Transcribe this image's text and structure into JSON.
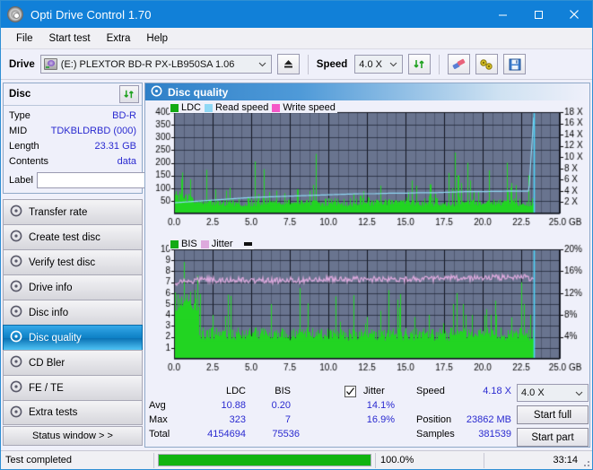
{
  "window": {
    "title": "Opti Drive Control 1.70",
    "icon": "disc-icon",
    "minimize": "minimize",
    "maximize": "maximize",
    "close": "close"
  },
  "menu": {
    "items": [
      "File",
      "Start test",
      "Extra",
      "Help"
    ]
  },
  "toolbar": {
    "drive_label": "Drive",
    "drive_value": "(E:)  PLEXTOR BD-R  PX-LB950SA 1.06",
    "eject_icon": "eject-icon",
    "speed_label": "Speed",
    "speed_value": "4.0 X",
    "refresh_icon": "refresh-icon",
    "eraser_icon": "eraser-icon",
    "tools_icon": "tools-icon",
    "save_icon": "save-icon"
  },
  "disc": {
    "header": "Disc",
    "refresh_icon": "refresh-icon",
    "rows": [
      {
        "key": "Type",
        "value": "BD-R"
      },
      {
        "key": "MID",
        "value": "TDKBLDRBD (000)"
      },
      {
        "key": "Length",
        "value": "23.31 GB"
      },
      {
        "key": "Contents",
        "value": "data"
      }
    ],
    "label_key": "Label",
    "label_value": "",
    "label_placeholder": "",
    "label_icon": "disc-label-icon"
  },
  "sidebar": {
    "items": [
      {
        "label": "Transfer rate",
        "icon": "disc-icon",
        "active": false
      },
      {
        "label": "Create test disc",
        "icon": "disc-icon",
        "active": false
      },
      {
        "label": "Verify test disc",
        "icon": "disc-icon",
        "active": false
      },
      {
        "label": "Drive info",
        "icon": "disc-icon",
        "active": false
      },
      {
        "label": "Disc info",
        "icon": "disc-icon",
        "active": false
      },
      {
        "label": "Disc quality",
        "icon": "disc-icon",
        "active": true
      },
      {
        "label": "CD Bler",
        "icon": "disc-icon",
        "active": false
      },
      {
        "label": "FE / TE",
        "icon": "disc-icon",
        "active": false
      },
      {
        "label": "Extra tests",
        "icon": "disc-icon",
        "active": false
      }
    ],
    "status_window_button": "Status window > >"
  },
  "panel": {
    "title": "Disc quality",
    "icon": "disc-icon"
  },
  "stats": {
    "col_ldc": "LDC",
    "col_bis": "BIS",
    "jitter_label": "Jitter",
    "jitter_checked": true,
    "rows": [
      {
        "name": "Avg",
        "ldc": "10.88",
        "bis": "0.20",
        "jitter": "14.1%"
      },
      {
        "name": "Max",
        "ldc": "323",
        "bis": "7",
        "jitter": "16.9%"
      },
      {
        "name": "Total",
        "ldc": "4154694",
        "bis": "75536",
        "jitter": ""
      }
    ],
    "speed_label": "Speed",
    "speed_value": "4.18 X",
    "position_label": "Position",
    "position_value": "23862 MB",
    "samples_label": "Samples",
    "samples_value": "381539",
    "speed_select": "4.0 X",
    "start_full_button": "Start full",
    "start_part_button": "Start part"
  },
  "statusbar": {
    "message": "Test completed",
    "progress_percent": "100.0%",
    "progress_value": 100,
    "elapsed": "33:14"
  },
  "colors": {
    "accent": "#1180d8",
    "plot_bg": "#69748f",
    "ldc_green": "#22d422",
    "read_speed": "#8fd8f5",
    "write_speed": "#f558c8",
    "jitter_pink": "#dda9dd",
    "value_blue": "#2a2ad0",
    "progress_green": "#11b411"
  },
  "chart_data": [
    {
      "type": "area",
      "title": "LDC / Read speed",
      "xlabel": "GB",
      "ylabel": "LDC",
      "xlim": [
        0,
        25.0
      ],
      "ylim": [
        0,
        400
      ],
      "xticks": [
        "0.0",
        "2.5",
        "5.0",
        "7.5",
        "10.0",
        "12.5",
        "15.0",
        "17.5",
        "20.0",
        "22.5",
        "25.0 GB"
      ],
      "yticks": [
        "400",
        "350",
        "300",
        "250",
        "200",
        "150",
        "100",
        "50"
      ],
      "y2label": "Speed",
      "y2lim": [
        0,
        19
      ],
      "y2ticks": [
        "18 X",
        "16 X",
        "14 X",
        "12 X",
        "10 X",
        "8 X",
        "6 X",
        "4 X",
        "2 X"
      ],
      "grid": true,
      "legend_position": "top-left",
      "legend": [
        {
          "name": "LDC",
          "color": "#13aa13"
        },
        {
          "name": "Read speed",
          "color": "#8fd8f5"
        },
        {
          "name": "Write speed",
          "color": "#f558c8"
        }
      ],
      "series": [
        {
          "name": "LDC",
          "color": "#22d422",
          "type": "impulse",
          "x": [
            0.0,
            0.1,
            0.2,
            0.3,
            0.4,
            0.5,
            0.6,
            0.7,
            0.8,
            0.9,
            1.0,
            1.1,
            1.2,
            1.3,
            1.4,
            1.5,
            1.6,
            1.7,
            1.8,
            1.9,
            2.0,
            2.1,
            2.2,
            2.3,
            2.4,
            2.5,
            2.6,
            2.7,
            2.8,
            2.9,
            3.0,
            3.2,
            3.4,
            3.6,
            3.8,
            4.0,
            4.2,
            4.4,
            4.6,
            4.8,
            5.0,
            5.2,
            5.4,
            5.6,
            5.8,
            6.0,
            6.2,
            6.4,
            6.6,
            6.8,
            7.0,
            7.2,
            7.4,
            7.6,
            7.8,
            8.0,
            8.2,
            8.4,
            8.6,
            8.8,
            9.0,
            9.2,
            9.4,
            9.6,
            9.8,
            10.0,
            10.2,
            10.4,
            10.6,
            10.8,
            11.0,
            11.4,
            11.8,
            12.2,
            12.6,
            13.0,
            13.4,
            13.8,
            14.2,
            14.6,
            15.0,
            15.4,
            15.8,
            16.2,
            16.6,
            17.0,
            17.4,
            17.8,
            18.0,
            18.2,
            18.4,
            18.6,
            18.8,
            19.0,
            19.2,
            19.4,
            19.6,
            19.8,
            20.0,
            20.2,
            20.4,
            20.8,
            21.2,
            21.6,
            22.0,
            22.4,
            22.8,
            23.0,
            23.2,
            23.3
          ],
          "values": [
            60,
            95,
            85,
            75,
            70,
            65,
            60,
            185,
            62,
            58,
            60,
            58,
            55,
            60,
            58,
            55,
            62,
            188,
            55,
            58,
            60,
            172,
            58,
            60,
            62,
            60,
            58,
            95,
            60,
            58,
            57,
            60,
            90,
            58,
            60,
            62,
            58,
            60,
            90,
            60,
            58,
            205,
            58,
            60,
            175,
            60,
            58,
            60,
            90,
            60,
            58,
            60,
            58,
            60,
            58,
            95,
            60,
            58,
            60,
            58,
            60,
            235,
            58,
            60,
            58,
            60,
            58,
            60,
            58,
            60,
            58,
            60,
            58,
            60,
            62,
            60,
            110,
            58,
            60,
            58,
            60,
            130,
            58,
            60,
            115,
            60,
            58,
            160,
            100,
            240,
            150,
            120,
            290,
            200,
            130,
            90,
            70,
            60,
            58,
            60,
            170,
            60,
            58,
            200,
            60,
            58,
            280,
            150,
            60,
            58
          ]
        },
        {
          "name": "Read speed",
          "color": "#8fd8f5",
          "type": "line",
          "x": [
            0.0,
            1.0,
            2.0,
            3.0,
            4.0,
            5.0,
            6.0,
            7.0,
            8.0,
            9.0,
            10.0,
            11.0,
            12.0,
            13.0,
            14.0,
            15.0,
            16.0,
            17.0,
            18.0,
            19.0,
            20.0,
            21.0,
            22.0,
            23.0,
            23.3
          ],
          "values": [
            2.0,
            2.2,
            2.4,
            2.6,
            2.8,
            3.0,
            3.1,
            3.2,
            3.3,
            3.4,
            3.5,
            3.6,
            3.7,
            3.7,
            3.8,
            3.8,
            3.9,
            3.9,
            4.0,
            4.1,
            4.1,
            4.15,
            4.18,
            4.2,
            18.0
          ]
        }
      ]
    },
    {
      "type": "area",
      "title": "BIS / Jitter",
      "xlabel": "GB",
      "ylabel": "BIS",
      "xlim": [
        0,
        25.0
      ],
      "ylim": [
        0,
        10
      ],
      "xticks": [
        "0.0",
        "2.5",
        "5.0",
        "7.5",
        "10.0",
        "12.5",
        "15.0",
        "17.5",
        "20.0",
        "22.5",
        "25.0 GB"
      ],
      "yticks": [
        "10",
        "9",
        "8",
        "7",
        "6",
        "5",
        "4",
        "3",
        "2",
        "1"
      ],
      "y2label": "Jitter",
      "y2lim": [
        0,
        20
      ],
      "y2ticks": [
        "20%",
        "16%",
        "12%",
        "8%",
        "4%"
      ],
      "grid": true,
      "legend_position": "top-left",
      "legend": [
        {
          "name": "BIS",
          "color": "#13aa13"
        },
        {
          "name": "Jitter",
          "color": "#dda9dd"
        }
      ],
      "series": [
        {
          "name": "BIS",
          "color": "#22d422",
          "type": "impulse",
          "x": [
            0.0,
            0.1,
            0.2,
            0.3,
            0.4,
            0.5,
            0.6,
            0.7,
            0.8,
            0.9,
            1.0,
            1.1,
            1.2,
            1.3,
            1.4,
            1.5,
            1.7,
            1.9,
            2.1,
            2.3,
            2.5,
            2.7,
            2.9,
            3.1,
            3.3,
            3.5,
            3.7,
            3.9,
            4.1,
            4.3,
            4.5,
            4.7,
            4.9,
            5.1,
            5.3,
            5.5,
            5.7,
            5.9,
            6.1,
            6.3,
            6.5,
            6.7,
            6.9,
            7.3,
            7.7,
            8.1,
            8.5,
            8.9,
            9.3,
            9.7,
            10.1,
            10.5,
            10.9,
            11.3,
            11.7,
            12.1,
            12.5,
            12.9,
            13.3,
            13.7,
            14.1,
            14.5,
            14.9,
            15.3,
            15.7,
            16.1,
            16.5,
            16.9,
            17.3,
            17.7,
            18.1,
            18.3,
            18.5,
            18.7,
            18.9,
            19.1,
            19.3,
            19.5,
            19.7,
            19.9,
            20.1,
            20.5,
            20.9,
            21.3,
            21.7,
            22.1,
            22.5,
            22.7,
            22.9,
            23.1,
            23.3
          ],
          "values": [
            5,
            5,
            5,
            5,
            5,
            5,
            6,
            6,
            5,
            6,
            6,
            4,
            6,
            4,
            6,
            3,
            3,
            3,
            3,
            3,
            4,
            3,
            3,
            3,
            3,
            3,
            3,
            3,
            3,
            3,
            3,
            3,
            3,
            3,
            3,
            3,
            4,
            3,
            3,
            5,
            3,
            3,
            3,
            3,
            3,
            3,
            3,
            2,
            3,
            3,
            3,
            3,
            3,
            3,
            3,
            3,
            3,
            3,
            3,
            3,
            3,
            3,
            4,
            3,
            3,
            3,
            4,
            3,
            3,
            3,
            5,
            6,
            4,
            5,
            4,
            3,
            4,
            3,
            3,
            3,
            4,
            4,
            4,
            5,
            4,
            6,
            7,
            5,
            6,
            4,
            3
          ]
        },
        {
          "name": "Jitter",
          "color": "#dda9dd",
          "type": "line",
          "x": [
            0.0,
            0.5,
            1.0,
            1.5,
            2.0,
            2.5,
            3.0,
            3.5,
            4.0,
            4.5,
            5.0,
            5.5,
            6.0,
            6.5,
            7.0,
            7.5,
            8.0,
            8.5,
            9.0,
            9.5,
            10.0,
            10.5,
            11.0,
            11.5,
            12.0,
            12.5,
            13.0,
            13.5,
            14.0,
            14.5,
            15.0,
            15.5,
            16.0,
            16.5,
            17.0,
            17.5,
            18.0,
            18.5,
            19.0,
            19.5,
            20.0,
            20.5,
            21.0,
            21.5,
            22.0,
            22.5,
            23.0,
            23.3
          ],
          "values": [
            13.8,
            14.2,
            14.1,
            14.4,
            14.5,
            14.4,
            14.2,
            14.3,
            14.5,
            14.3,
            14.2,
            14.4,
            14.3,
            14.2,
            14.4,
            14.5,
            14.3,
            14.4,
            14.5,
            14.3,
            14.6,
            14.5,
            14.4,
            14.6,
            14.5,
            14.4,
            14.6,
            14.7,
            14.5,
            14.6,
            14.5,
            14.7,
            14.6,
            14.5,
            14.7,
            14.6,
            14.8,
            14.6,
            14.7,
            14.8,
            14.7,
            14.9,
            14.8,
            15.0,
            14.9,
            15.0,
            14.8,
            14.7
          ]
        }
      ]
    }
  ]
}
